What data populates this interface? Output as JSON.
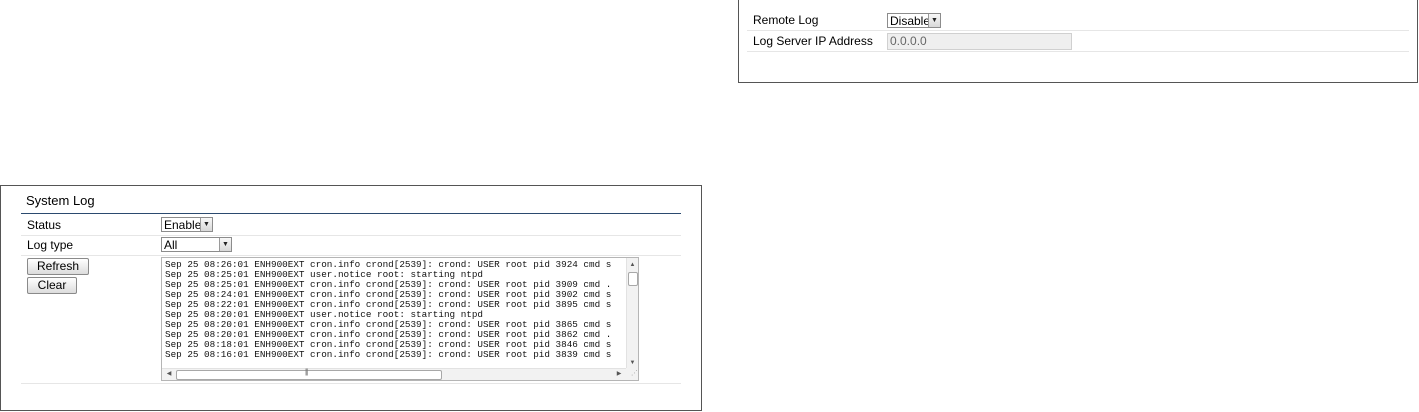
{
  "remote_log": {
    "label": "Remote Log",
    "selected": "Disable",
    "server_ip_label": "Log Server IP Address",
    "server_ip_value": "0.0.0.0"
  },
  "system_log": {
    "title": "System Log",
    "status_label": "Status",
    "status_selected": "Enable",
    "log_type_label": "Log type",
    "log_type_selected": "All",
    "refresh_label": "Refresh",
    "clear_label": "Clear",
    "lines": [
      "Sep 25 08:26:01 ENH900EXT cron.info crond[2539]: crond: USER root pid 3924 cmd s",
      "Sep 25 08:25:01 ENH900EXT user.notice root: starting ntpd",
      "Sep 25 08:25:01 ENH900EXT cron.info crond[2539]: crond: USER root pid 3909 cmd .",
      "Sep 25 08:24:01 ENH900EXT cron.info crond[2539]: crond: USER root pid 3902 cmd s",
      "Sep 25 08:22:01 ENH900EXT cron.info crond[2539]: crond: USER root pid 3895 cmd s",
      "Sep 25 08:20:01 ENH900EXT user.notice root: starting ntpd",
      "Sep 25 08:20:01 ENH900EXT cron.info crond[2539]: crond: USER root pid 3865 cmd s",
      "Sep 25 08:20:01 ENH900EXT cron.info crond[2539]: crond: USER root pid 3862 cmd .",
      "Sep 25 08:18:01 ENH900EXT cron.info crond[2539]: crond: USER root pid 3846 cmd s",
      "Sep 25 08:16:01 ENH900EXT cron.info crond[2539]: crond: USER root pid 3839 cmd s"
    ]
  },
  "icons": {
    "dropdown": "chevron-down-icon",
    "scroll_up": "scroll-up-arrow-icon",
    "scroll_down": "scroll-down-arrow-icon",
    "scroll_left": "scroll-left-arrow-icon",
    "scroll_right": "scroll-right-arrow-icon",
    "resize": "resize-grip-icon"
  },
  "colors": {
    "panel_border": "#555555",
    "title_rule": "#2b4a6f",
    "row_divider": "#e6e6e6",
    "disabled_field": "#efefef"
  }
}
